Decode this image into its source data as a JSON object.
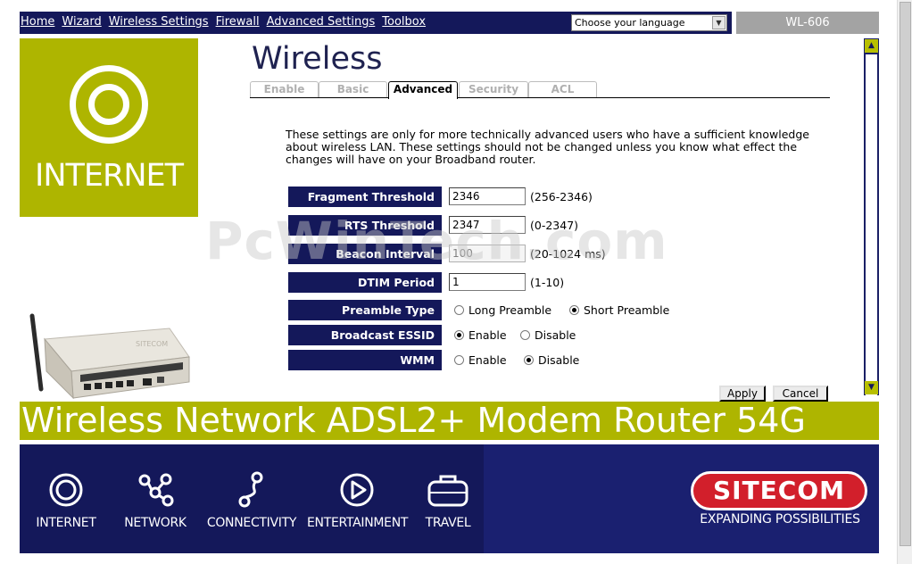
{
  "nav": {
    "links": [
      "Home",
      "Wizard",
      "Wireless Settings",
      "Firewall",
      "Advanced Settings",
      "Toolbox"
    ],
    "language_select": "Choose your language",
    "model": "WL-606"
  },
  "logo": {
    "text": "INTERNET"
  },
  "page": {
    "title": "Wireless",
    "tabs": [
      {
        "label": "Enable",
        "active": false
      },
      {
        "label": "Basic",
        "active": false
      },
      {
        "label": "Advanced",
        "active": true
      },
      {
        "label": "Security",
        "active": false
      },
      {
        "label": "ACL",
        "active": false
      }
    ],
    "description": "These settings are only for more technically advanced users who have a sufficient knowledge about wireless LAN. These settings should not be changed unless you know what effect the changes will have on your Broadband router."
  },
  "settings": {
    "fragment_threshold": {
      "label": "Fragment Threshold",
      "value": "2346",
      "range": "(256-2346)"
    },
    "rts_threshold": {
      "label": "RTS Threshold",
      "value": "2347",
      "range": "(0-2347)"
    },
    "beacon_interval": {
      "label": "Beacon Interval",
      "value": "100",
      "range": "(20-1024 ms)"
    },
    "dtim_period": {
      "label": "DTIM Period",
      "value": "1",
      "range": "(1-10)"
    },
    "preamble_type": {
      "label": "Preamble Type",
      "options": [
        "Long Preamble",
        "Short Preamble"
      ],
      "selected": "Short Preamble"
    },
    "broadcast_essid": {
      "label": "Broadcast ESSID",
      "options": [
        "Enable",
        "Disable"
      ],
      "selected": "Enable"
    },
    "wmm": {
      "label": "WMM",
      "options": [
        "Enable",
        "Disable"
      ],
      "selected": "Disable"
    }
  },
  "buttons": {
    "apply": "Apply",
    "cancel": "Cancel"
  },
  "watermark": "PcWinTech.com",
  "banner": {
    "text": "Wireless Network ADSL2+ Modem Router 54G"
  },
  "footer": {
    "items": [
      {
        "label": "INTERNET",
        "icon": "internet-icon"
      },
      {
        "label": "NETWORK",
        "icon": "network-icon"
      },
      {
        "label": "CONNECTIVITY",
        "icon": "connectivity-icon"
      },
      {
        "label": "ENTERTAINMENT",
        "icon": "entertainment-icon"
      },
      {
        "label": "TRAVEL",
        "icon": "travel-icon"
      }
    ],
    "brand": "SITECOM",
    "tagline": "EXPANDING POSSIBILITIES"
  },
  "colors": {
    "navy": "#14185a",
    "olive": "#aeb500",
    "brand_red": "#d21f2b"
  }
}
